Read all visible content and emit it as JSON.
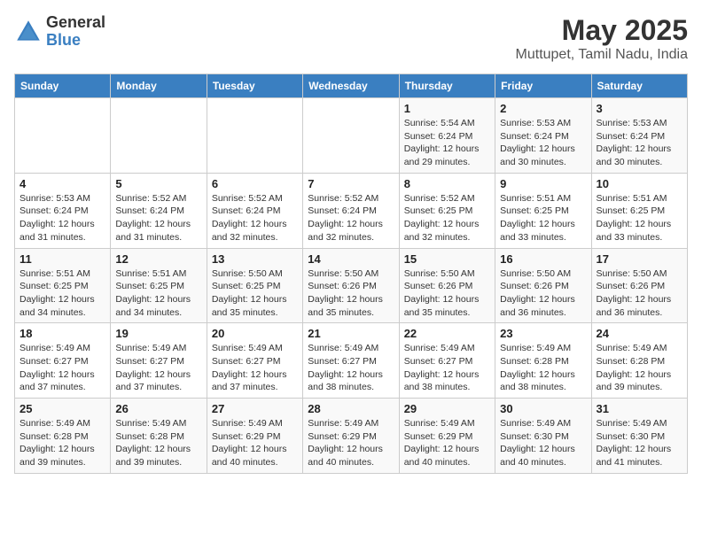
{
  "logo": {
    "general": "General",
    "blue": "Blue"
  },
  "title": "May 2025",
  "subtitle": "Muttupet, Tamil Nadu, India",
  "days_header": [
    "Sunday",
    "Monday",
    "Tuesday",
    "Wednesday",
    "Thursday",
    "Friday",
    "Saturday"
  ],
  "weeks": [
    [
      {
        "day": "",
        "info": ""
      },
      {
        "day": "",
        "info": ""
      },
      {
        "day": "",
        "info": ""
      },
      {
        "day": "",
        "info": ""
      },
      {
        "day": "1",
        "info": "Sunrise: 5:54 AM\nSunset: 6:24 PM\nDaylight: 12 hours\nand 29 minutes."
      },
      {
        "day": "2",
        "info": "Sunrise: 5:53 AM\nSunset: 6:24 PM\nDaylight: 12 hours\nand 30 minutes."
      },
      {
        "day": "3",
        "info": "Sunrise: 5:53 AM\nSunset: 6:24 PM\nDaylight: 12 hours\nand 30 minutes."
      }
    ],
    [
      {
        "day": "4",
        "info": "Sunrise: 5:53 AM\nSunset: 6:24 PM\nDaylight: 12 hours\nand 31 minutes."
      },
      {
        "day": "5",
        "info": "Sunrise: 5:52 AM\nSunset: 6:24 PM\nDaylight: 12 hours\nand 31 minutes."
      },
      {
        "day": "6",
        "info": "Sunrise: 5:52 AM\nSunset: 6:24 PM\nDaylight: 12 hours\nand 32 minutes."
      },
      {
        "day": "7",
        "info": "Sunrise: 5:52 AM\nSunset: 6:24 PM\nDaylight: 12 hours\nand 32 minutes."
      },
      {
        "day": "8",
        "info": "Sunrise: 5:52 AM\nSunset: 6:25 PM\nDaylight: 12 hours\nand 32 minutes."
      },
      {
        "day": "9",
        "info": "Sunrise: 5:51 AM\nSunset: 6:25 PM\nDaylight: 12 hours\nand 33 minutes."
      },
      {
        "day": "10",
        "info": "Sunrise: 5:51 AM\nSunset: 6:25 PM\nDaylight: 12 hours\nand 33 minutes."
      }
    ],
    [
      {
        "day": "11",
        "info": "Sunrise: 5:51 AM\nSunset: 6:25 PM\nDaylight: 12 hours\nand 34 minutes."
      },
      {
        "day": "12",
        "info": "Sunrise: 5:51 AM\nSunset: 6:25 PM\nDaylight: 12 hours\nand 34 minutes."
      },
      {
        "day": "13",
        "info": "Sunrise: 5:50 AM\nSunset: 6:25 PM\nDaylight: 12 hours\nand 35 minutes."
      },
      {
        "day": "14",
        "info": "Sunrise: 5:50 AM\nSunset: 6:26 PM\nDaylight: 12 hours\nand 35 minutes."
      },
      {
        "day": "15",
        "info": "Sunrise: 5:50 AM\nSunset: 6:26 PM\nDaylight: 12 hours\nand 35 minutes."
      },
      {
        "day": "16",
        "info": "Sunrise: 5:50 AM\nSunset: 6:26 PM\nDaylight: 12 hours\nand 36 minutes."
      },
      {
        "day": "17",
        "info": "Sunrise: 5:50 AM\nSunset: 6:26 PM\nDaylight: 12 hours\nand 36 minutes."
      }
    ],
    [
      {
        "day": "18",
        "info": "Sunrise: 5:49 AM\nSunset: 6:27 PM\nDaylight: 12 hours\nand 37 minutes."
      },
      {
        "day": "19",
        "info": "Sunrise: 5:49 AM\nSunset: 6:27 PM\nDaylight: 12 hours\nand 37 minutes."
      },
      {
        "day": "20",
        "info": "Sunrise: 5:49 AM\nSunset: 6:27 PM\nDaylight: 12 hours\nand 37 minutes."
      },
      {
        "day": "21",
        "info": "Sunrise: 5:49 AM\nSunset: 6:27 PM\nDaylight: 12 hours\nand 38 minutes."
      },
      {
        "day": "22",
        "info": "Sunrise: 5:49 AM\nSunset: 6:27 PM\nDaylight: 12 hours\nand 38 minutes."
      },
      {
        "day": "23",
        "info": "Sunrise: 5:49 AM\nSunset: 6:28 PM\nDaylight: 12 hours\nand 38 minutes."
      },
      {
        "day": "24",
        "info": "Sunrise: 5:49 AM\nSunset: 6:28 PM\nDaylight: 12 hours\nand 39 minutes."
      }
    ],
    [
      {
        "day": "25",
        "info": "Sunrise: 5:49 AM\nSunset: 6:28 PM\nDaylight: 12 hours\nand 39 minutes."
      },
      {
        "day": "26",
        "info": "Sunrise: 5:49 AM\nSunset: 6:28 PM\nDaylight: 12 hours\nand 39 minutes."
      },
      {
        "day": "27",
        "info": "Sunrise: 5:49 AM\nSunset: 6:29 PM\nDaylight: 12 hours\nand 40 minutes."
      },
      {
        "day": "28",
        "info": "Sunrise: 5:49 AM\nSunset: 6:29 PM\nDaylight: 12 hours\nand 40 minutes."
      },
      {
        "day": "29",
        "info": "Sunrise: 5:49 AM\nSunset: 6:29 PM\nDaylight: 12 hours\nand 40 minutes."
      },
      {
        "day": "30",
        "info": "Sunrise: 5:49 AM\nSunset: 6:30 PM\nDaylight: 12 hours\nand 40 minutes."
      },
      {
        "day": "31",
        "info": "Sunrise: 5:49 AM\nSunset: 6:30 PM\nDaylight: 12 hours\nand 41 minutes."
      }
    ]
  ]
}
